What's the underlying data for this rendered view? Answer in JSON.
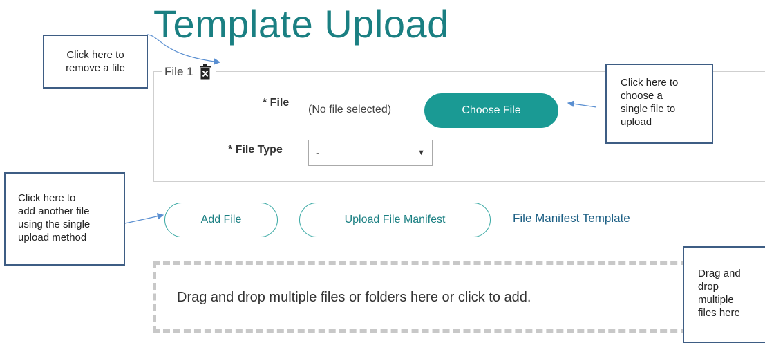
{
  "page_title": "Template Upload",
  "file_group": {
    "legend": "File 1",
    "file_label": "* File",
    "file_status": "(No file selected)",
    "choose_button": "Choose File",
    "file_type_label": "* File Type",
    "file_type_value": "-"
  },
  "actions": {
    "add_file": "Add File",
    "upload_manifest": "Upload File Manifest",
    "manifest_template_link": "File Manifest Template"
  },
  "dropzone": {
    "text": "Drag and drop multiple files or folders here or click to add."
  },
  "callouts": {
    "remove": [
      "Click here to",
      "remove a file"
    ],
    "choose": [
      "Click here to",
      "choose a",
      "single file to",
      "upload"
    ],
    "add": [
      "Click here to",
      "add another file",
      "using the single",
      "upload method"
    ],
    "drag": [
      "Drag and",
      "drop",
      "multiple",
      "files here"
    ]
  },
  "colors": {
    "accent": "#1a9a94",
    "title": "#1a7f82",
    "link": "#1c5f84",
    "callout_border": "#3e5d84"
  },
  "icons": {
    "remove": "trash-icon",
    "select": "caret-down-icon"
  }
}
